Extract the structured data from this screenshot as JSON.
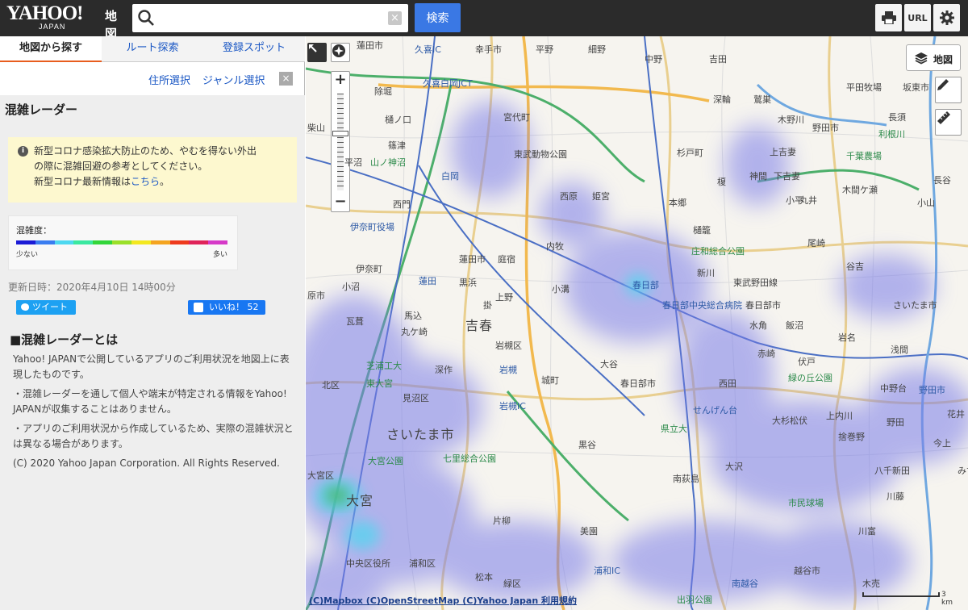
{
  "header": {
    "logo_text": "YAHOO!",
    "logo_sub": "JAPAN",
    "logo_map": "地図",
    "search_placeholder": "",
    "search_button": "検索",
    "url_button": "URL",
    "clear": "×"
  },
  "tabs": [
    {
      "label": "地図から探す"
    },
    {
      "label": "ルート探索"
    },
    {
      "label": "登録スポット"
    }
  ],
  "sublinks": {
    "address": "住所選択",
    "genre": "ジャンル選択",
    "close": "×"
  },
  "panel": {
    "title": "混雑レーダー",
    "notice_l1": "新型コロナ感染拡大防止のため、やむを得ない外出",
    "notice_l2": "の際に混雑回避の参考としてください。",
    "notice_l3": "新型コロナ最新情報は",
    "notice_link": "こちら",
    "notice_end": "。",
    "legend_title": "混雑度：",
    "legend_low": "少ない",
    "legend_high": "多い",
    "legend_colors": [
      "#1b1bd6",
      "#3a7df0",
      "#4ed8f0",
      "#3be8a0",
      "#33d63a",
      "#9be02a",
      "#f3e820",
      "#f4a420",
      "#ee3b1e",
      "#e0245a",
      "#d63ac8"
    ],
    "updated": "更新日時：2020年4月10日 14時00分",
    "tweet": "ツイート",
    "like": "いいね！ 52",
    "about_title": "■混雑レーダーとは",
    "about_p1_l1": "Yahoo! JAPANで公開しているアプリのご利用状況を地図上に表",
    "about_p1_l2": "現したものです。",
    "about_p2_l1": "・混雑レーダーを通して個人や端末が特定される情報をYahoo!",
    "about_p2_l2": "JAPANが収集することはありません。",
    "about_p3_l1": "・アプリのご利用状況から作成しているため、実際の混雑状況と",
    "about_p3_l2": "は異なる場合があります。",
    "copyright": "(C) 2020 Yahoo Japan Corporation. All Rights Reserved."
  },
  "map": {
    "layer_button": "地図",
    "attribution": "(C)Mapbox (C)OpenStreetMap (C)Yahoo Japan 利用規約",
    "scale": "3 km",
    "labels": [
      "蓮田市",
      "久喜IC",
      "幸手市",
      "平野",
      "細野",
      "中野",
      "吉田",
      "平田牧場",
      "坂東市",
      "宮代町",
      "除堀",
      "久喜白岡JCT",
      "柴山",
      "樋ノ口",
      "篠津",
      "白岡",
      "深輪",
      "鷲巣",
      "木野川",
      "野田市",
      "長須",
      "利根川",
      "杉戸町",
      "上吉妻",
      "千葉農場",
      "東武動物公園",
      "山ノ神沼",
      "平沼",
      "西原",
      "姫宮",
      "榎",
      "神間",
      "下吉妻",
      "木間ケ瀬",
      "長谷",
      "小山",
      "伊奈町役場",
      "西門",
      "本郷",
      "小平",
      "丸井",
      "内牧",
      "樋籠",
      "蓮田市",
      "庭宿",
      "黒浜",
      "上野",
      "小溝",
      "尾崎",
      "伊奈町",
      "蓮田",
      "庄和総合公園",
      "新川",
      "谷吉",
      "原市",
      "小沼",
      "掛",
      "春日部",
      "東武野田線",
      "春日部市",
      "吉春",
      "さいたま市",
      "瓦葺",
      "馬込",
      "丸ケ崎",
      "岩槻区",
      "水角",
      "飯沼",
      "岩名",
      "春日部中央総合病院",
      "浅間",
      "赤崎",
      "伏戸",
      "芝浦工大",
      "東大宮",
      "深作",
      "岩槻",
      "城町",
      "大谷",
      "緑の丘公園",
      "北区",
      "見沼区",
      "春日部市",
      "西田",
      "中野台",
      "野田市",
      "さいたま市",
      "岩槻IC",
      "せんげん台",
      "県立大",
      "大杉",
      "松伏",
      "上内川",
      "花井",
      "黒谷",
      "捨巻野",
      "野田",
      "今上",
      "大宮公園",
      "七里総合公園",
      "大沢",
      "八千新田",
      "みずき",
      "大宮区",
      "大宮",
      "南荻島",
      "市民球場",
      "川藤",
      "片柳",
      "川富",
      "中央区役所",
      "浦和区",
      "美園",
      "浦和IC",
      "松本",
      "越谷市",
      "緑区",
      "南越谷",
      "出羽公園",
      "木売"
    ]
  }
}
